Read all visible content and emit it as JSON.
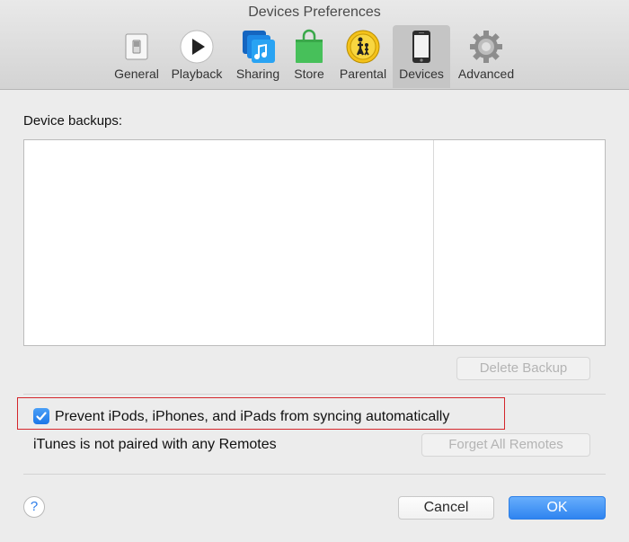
{
  "window": {
    "title": "Devices Preferences"
  },
  "tabs": [
    {
      "label": "General",
      "icon": "general-switch-icon"
    },
    {
      "label": "Playback",
      "icon": "play-icon"
    },
    {
      "label": "Sharing",
      "icon": "sharing-music-icon"
    },
    {
      "label": "Store",
      "icon": "store-bag-icon"
    },
    {
      "label": "Parental",
      "icon": "parental-icon"
    },
    {
      "label": "Devices",
      "icon": "iphone-icon",
      "active": true
    },
    {
      "label": "Advanced",
      "icon": "gear-icon"
    }
  ],
  "backups": {
    "label": "Device backups:",
    "delete_label": "Delete Backup"
  },
  "sync": {
    "prevent_label": "Prevent iPods, iPhones, and iPads from syncing automatically",
    "checked": true
  },
  "remotes": {
    "status": "iTunes is not paired with any Remotes",
    "forget_label": "Forget All Remotes"
  },
  "footer": {
    "help_label": "?",
    "cancel_label": "Cancel",
    "ok_label": "OK"
  },
  "colors": {
    "accent": "#2f84f0",
    "highlight": "#d4262b"
  }
}
